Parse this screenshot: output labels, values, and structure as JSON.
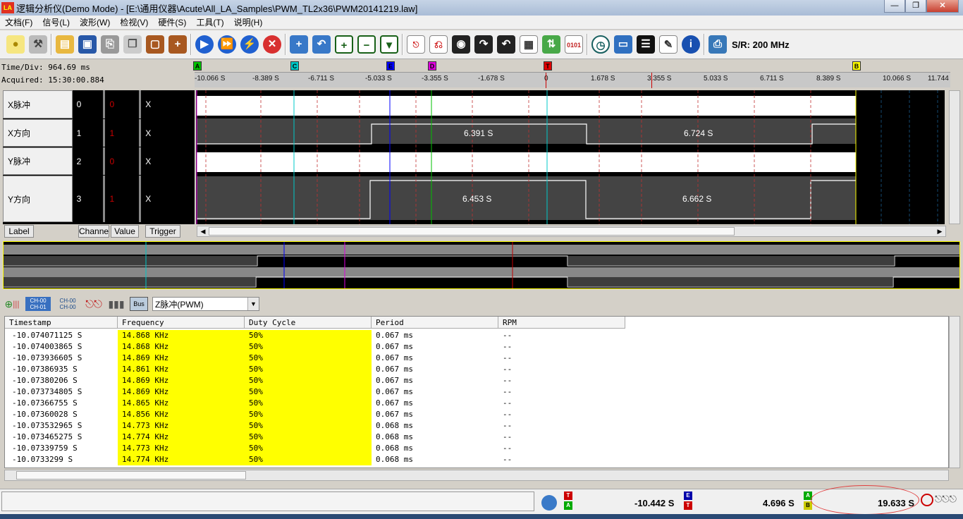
{
  "window": {
    "title": "逻辑分析仪(Demo Mode) - [E:\\通用仪器\\Acute\\All_LA_Samples\\PWM_TL2x36\\PWM20141219.law]",
    "logo": "LA"
  },
  "menus": [
    "文档(F)",
    "信号(L)",
    "波形(W)",
    "检视(V)",
    "硬件(S)",
    "工具(T)",
    "说明(H)"
  ],
  "toolbar": {
    "icons": [
      "bulb-icon",
      "wrench-icon",
      "open-folder-icon",
      "save-icon",
      "print-icon",
      "copy-icon",
      "briefcase-icon",
      "briefcase-plus-icon",
      "run-icon",
      "run-repeat-icon",
      "run-single-icon",
      "stop-icon",
      "zoom-add-icon",
      "zoom-back-icon",
      "zoom-in-icon",
      "zoom-out-icon",
      "zoom-menu-icon",
      "trigger-edge-icon",
      "trigger-level-icon",
      "search-icon",
      "find-next-icon",
      "find-prev-icon",
      "table-icon",
      "sync-icon",
      "counter-icon",
      "clock-icon",
      "window-icon",
      "lines-icon",
      "notes-icon",
      "info-icon",
      "sample-rate-icon"
    ],
    "sample_rate": "S/R: 200 MHz"
  },
  "info": {
    "time_div": "Time/Div: 964.69 ms",
    "acquired": "Acquired: 15:30:00.884"
  },
  "ruler": {
    "ticks": [
      "-10.066 S",
      "-8.389 S",
      "-6.711 S",
      "-5.033 S",
      "-3.355 S",
      "-1.678 S",
      "0",
      "1.678 S",
      "3.355 S",
      "5.033 S",
      "6.711 S",
      "8.389 S",
      "10.066 S",
      "11.744"
    ]
  },
  "markers": [
    {
      "label": "A",
      "color": "#00c000"
    },
    {
      "label": "C",
      "color": "#00c8c8"
    },
    {
      "label": "E",
      "color": "#0000ff"
    },
    {
      "label": "D",
      "color": "#e000e0"
    },
    {
      "label": "T",
      "color": "#e00000"
    },
    {
      "label": "B",
      "color": "#ffff00"
    }
  ],
  "channels": [
    {
      "name": "X脉冲",
      "num": "0",
      "value": "0",
      "trigger": "X"
    },
    {
      "name": "X方向",
      "num": "1",
      "value": "1",
      "trigger": "X",
      "widths": [
        "6.391 S",
        "6.724 S"
      ]
    },
    {
      "name": "Y脉冲",
      "num": "2",
      "value": "0",
      "trigger": "X"
    },
    {
      "name": "Y方向",
      "num": "3",
      "value": "1",
      "trigger": "X",
      "widths": [
        "6.453 S",
        "6.662 S"
      ]
    }
  ],
  "column_labels": {
    "label": "Label",
    "channel": "Channe",
    "value": "Value",
    "trigger": "Trigger"
  },
  "decode": {
    "select": "Z脉冲(PWM)",
    "icons": [
      "decode-add-icon",
      "ch-01-icon",
      "ch-00-icon",
      "pulse-icon",
      "histogram-icon",
      "bus-icon"
    ],
    "ch_top": "CH-00",
    "ch_bottom": "CH-01",
    "bus": "Bus"
  },
  "table": {
    "headers": [
      "Timestamp",
      "Frequency",
      "Duty Cycle",
      "Period",
      "RPM"
    ],
    "rows": [
      [
        "-10.074071125 S",
        "14.868 KHz",
        "50%",
        "0.067 ms",
        "--"
      ],
      [
        "-10.074003865 S",
        "14.868 KHz",
        "50%",
        "0.067 ms",
        "--"
      ],
      [
        "-10.073936605 S",
        "14.869 KHz",
        "50%",
        "0.067 ms",
        "--"
      ],
      [
        "-10.07386935 S",
        "14.861 KHz",
        "50%",
        "0.067 ms",
        "--"
      ],
      [
        "-10.07380206 S",
        "14.869 KHz",
        "50%",
        "0.067 ms",
        "--"
      ],
      [
        "-10.073734805 S",
        "14.869 KHz",
        "50%",
        "0.067 ms",
        "--"
      ],
      [
        "-10.07366755 S",
        "14.865 KHz",
        "50%",
        "0.067 ms",
        "--"
      ],
      [
        "-10.07360028 S",
        "14.856 KHz",
        "50%",
        "0.067 ms",
        "--"
      ],
      [
        "-10.073532965 S",
        "14.773 KHz",
        "50%",
        "0.068 ms",
        "--"
      ],
      [
        "-10.073465275 S",
        "14.774 KHz",
        "50%",
        "0.068 ms",
        "--"
      ],
      [
        "-10.07339759 S",
        "14.773 KHz",
        "50%",
        "0.068 ms",
        "--"
      ],
      [
        "-10.0733299 S",
        "14.774 KHz",
        "50%",
        "0.068 ms",
        "--"
      ]
    ]
  },
  "status": {
    "t_a": "-10.442 S",
    "e_t": "4.696 S",
    "a_b": "19.633 S",
    "badges": [
      "T",
      "A",
      "E",
      "T",
      "A",
      "B"
    ]
  }
}
